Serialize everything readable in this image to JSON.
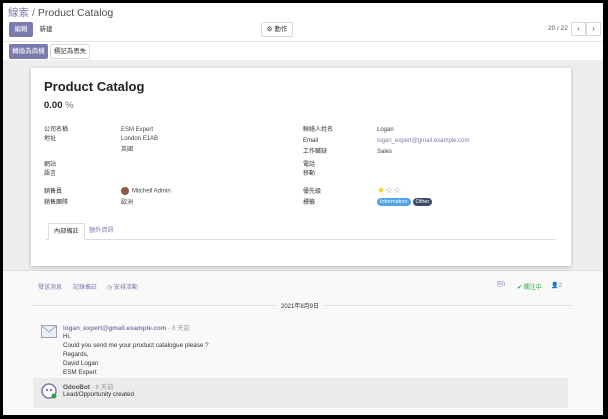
{
  "breadcrumb": {
    "parent": "線索",
    "separator": "/",
    "current": "Product Catalog"
  },
  "toolbar": {
    "edit_label": "編輯",
    "create_label": "新建",
    "action_label": "動作"
  },
  "pager": {
    "value": "20 / 22",
    "prev": "‹",
    "next": "›"
  },
  "status_buttons": {
    "convert_label": "轉換為商機",
    "lost_label": "標記為丟失"
  },
  "record": {
    "title": "Product Catalog",
    "probability": "0.00",
    "probability_unit": "%",
    "left_fields": [
      {
        "label": "公司名稱",
        "value": "ESM Expert"
      },
      {
        "label": "地址",
        "value": "London  E1AB"
      },
      {
        "label": "",
        "value": "英國"
      },
      {
        "label": "網站",
        "value": ""
      },
      {
        "label": "語言",
        "value": ""
      },
      {
        "label": "銷售員",
        "value": "Mitchell Admin"
      },
      {
        "label": "銷售團隊",
        "value": "歐洲"
      }
    ],
    "right_fields": [
      {
        "label": "聯絡人姓名",
        "value": "Logan"
      },
      {
        "label": "Email",
        "value": "logan_expert@gmail.example.com"
      },
      {
        "label": "工作職缺",
        "value": "Sales"
      },
      {
        "label": "電話",
        "value": ""
      },
      {
        "label": "移動",
        "value": ""
      },
      {
        "label": "優先級",
        "value": ""
      },
      {
        "label": "標籤",
        "value": ""
      }
    ],
    "priority": {
      "stars": 1,
      "max": 3
    },
    "tags": [
      {
        "name": "Information",
        "color": "#4fa4e8"
      },
      {
        "name": "Other",
        "color": "#3d4a6b"
      }
    ],
    "tabs": [
      {
        "label": "內部備註"
      },
      {
        "label": "額外資訊"
      }
    ]
  },
  "chatter": {
    "send_message": "發送消息",
    "log_note": "記錄備註",
    "schedule_activity": "安排活動",
    "attachments_count": "0",
    "follow_label": "關注中",
    "followers_count": "2",
    "date_separator": "2021年8月9日",
    "messages": [
      {
        "author": "logan_expert@gmail.example.com",
        "time": "- 8 天前",
        "lines": [
          "Hi,",
          "Could you send me your product catalogue please ?",
          "Regards,",
          "David Logan",
          "ESM Expert"
        ]
      },
      {
        "author": "OdooBot",
        "time": "- 8 天前",
        "lines": [
          "Lead/Opportunity created"
        ]
      }
    ]
  },
  "colors": {
    "accent": "#7c7bad",
    "star": "#f3cc00",
    "follow": "#28a745"
  }
}
